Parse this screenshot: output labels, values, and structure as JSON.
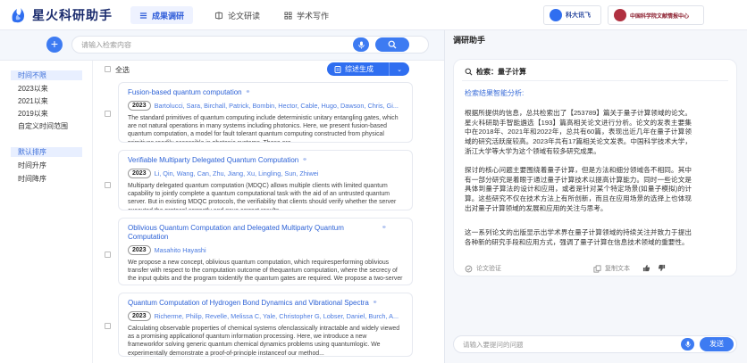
{
  "app": {
    "title": "星火科研助手"
  },
  "nav": {
    "tabs": [
      {
        "label": "成果调研",
        "active": true
      },
      {
        "label": "论文研读",
        "active": false
      },
      {
        "label": "学术写作",
        "active": false
      }
    ]
  },
  "partners": [
    {
      "label": "科大讯飞"
    },
    {
      "label": "中国科学院文献情报中心"
    }
  ],
  "search": {
    "placeholder": "请输入检索内容"
  },
  "filters": {
    "time_header": "时间不限",
    "time_options": [
      "2023以来",
      "2021以来",
      "2019以来",
      "自定义时间范围"
    ],
    "sort_header": "默认排序",
    "sort_options": [
      "时间升序",
      "时间降序"
    ]
  },
  "results": {
    "select_all_label": "全选",
    "generate_label": "综述生成",
    "papers": [
      {
        "title": "Fusion-based quantum computation",
        "year": "2023",
        "authors": "Bartolucci, Sara, Birchall, Patrick, Bombin, Hector, Cable, Hugo, Dawson, Chris, Gi...",
        "abstract": "The standard primitives of quantum computing include deterministic unitary entangling gates, which are not natural operations in many systems including photonics. Here, we present fusion-based quantum computation, a model for fault tolerant quantum computing constructed from physical primitives readily accessible in photonic systems. These are..."
      },
      {
        "title": "Verifiable Multiparty Delegated Quantum Computation",
        "year": "2023",
        "authors": "Li, Qin, Wang, Can, Zhu, Jiang, Xu, Lingling, Sun, Zhiwei",
        "abstract": "Multiparty delegated quantum computation (MDQC) allows multiple clients with limited quantum capability to jointly complete a quantum computational task with the aid of an untrusted quantum server. But in existing MDQC protocols, the verifiability that clients should verify whether the server executed the protocol correctly and gave correct results..."
      },
      {
        "title": "Oblivious Quantum Computation and Delegated Multiparty Quantum Computation",
        "year": "2023",
        "authors": "Masahito Hayashi",
        "abstract": "We propose a new concept, oblivious quantum computation, which requiresperforming oblivious transfer with respect to the computation outcome of thequantum computation, where the secrecy of the input qubits and the program toidentify the quantum gates are required. We propose a two-server protocol forthis task, which realizes an exponential..."
      },
      {
        "title": "Quantum Computation of Hydrogen Bond Dynamics and Vibrational Spectra",
        "year": "2023",
        "authors": "Richerme, Philip, Revelle, Melissa C, Yale, Christopher G, Lobser, Daniel, Burch, A...",
        "abstract": "Calculating observable properties of chemical systems ofenclassically intractable and widely viewed as a promising applicationof quantum information processing. Here, we introduce a new frameworkfor solving generic quantum chemical dynamics problems using quantumlogic. We experimentally demonstrate a proof-of-principle instanceof our method..."
      }
    ]
  },
  "assistant": {
    "title": "调研助手",
    "query_label": "检索：量子计算",
    "analysis_label": "检索结果智能分析:",
    "paragraphs": [
      "根据所提供的信息，总共检索出了【253789】篇关于量子计算领域的论文。星火科研助手智能遴选【193】篇高相关论文进行分析。论文的发表主要集中在2018年、2021年和2022年，总共有60篇，表现出近几年在量子计算领域的研究活跃度较高。2023年共有17篇相关论文发表。中国科学技术大学，浙江大学等大学为这个领域有较多研究成果。",
      "探讨的核心问题主要围绕着量子计算，但是方法和细分领域各不相同。其中有一部分研究是着眼于通过量子计算技术以提高计算能力。同时一些论文是具体到量子算法的设计和应用，或者是针对某个特定场景(如量子模拟)的计算。这些研究不仅在技术方法上有所创新，而且在应用场景的选择上也体现出对量子计算领域的发展和应用的关注与思考。",
      "这一系列论文的出版显示出学术界在量子计算领域的持续关注并致力于提出各种新的研究手段和应用方式，强调了量子计算在信息技术领域的重要性。"
    ],
    "verify_label": "论文验证",
    "copy_label": "复制文本",
    "chat_placeholder": "请输入要提问的问题",
    "send_label": "发送"
  },
  "colors": {
    "accent": "#3d7bf2",
    "link": "#2d62d6",
    "nav_active_bg": "#eef2ff"
  }
}
